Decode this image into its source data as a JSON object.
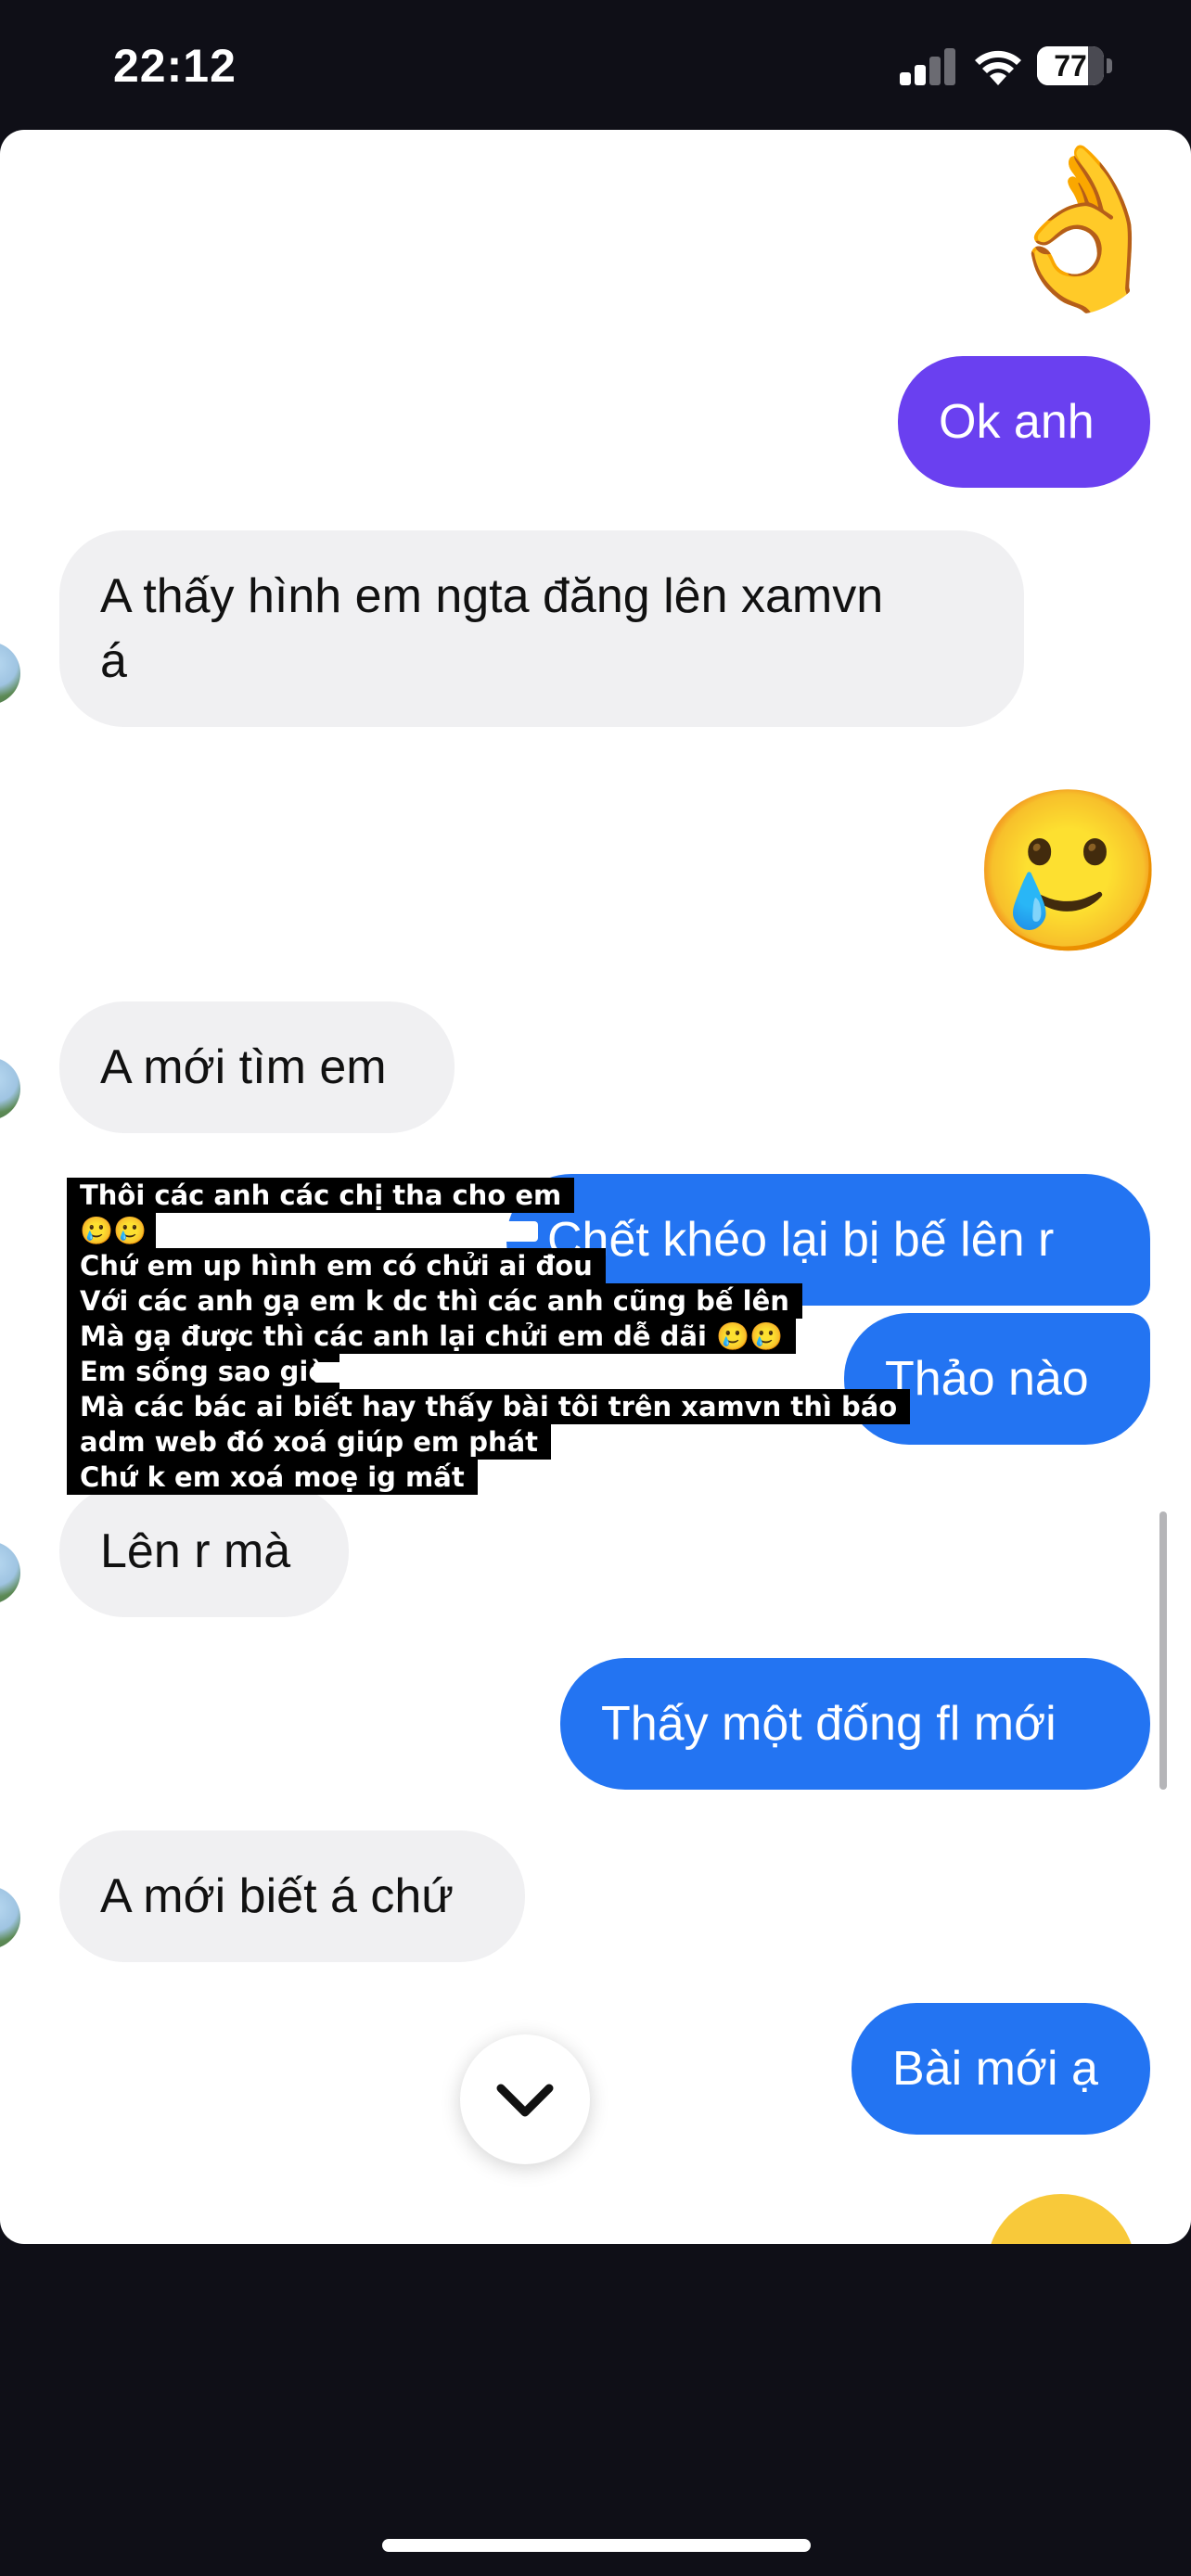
{
  "status_bar": {
    "time": "22:12",
    "battery_percent": 77,
    "battery_label": "77"
  },
  "colors": {
    "outgoing_purple": "#6a40f0",
    "outgoing_blue": "#2374f2",
    "incoming_gray": "#f0f0f2"
  },
  "messages": {
    "m1_emoji": "👌",
    "m2": "Ok anh",
    "m3_line1": "A thấy hình em ngta đăng lên xamvn",
    "m3_line2": "á",
    "m4_emoji": "🥲",
    "m5": "A mới tìm em",
    "m6": "Chết khéo lại bị bế lên r",
    "m7": "Thảo nào",
    "m8": "Lên r mà",
    "m9": "Thấy một đống fl mới",
    "m10": "A mới biết á chứ",
    "m11": "Bài mới ạ"
  },
  "overlay_text": {
    "line1": "Thôi các anh các chị tha cho em",
    "line2": "🥲🥲",
    "line3": "Chứ em up hình em có chửi ai đou",
    "line4": "Với các anh gạ em k dc thì các anh cũng bế lên",
    "line5": "Mà gạ được thì các anh lại chửi em dễ dãi 🥲🥲",
    "line6": "Em sống sao giờ",
    "line7": "Mà các bác ai biết hay thấy bài tôi trên xamvn thì báo",
    "line8": "adm web đó xoá giúp em phát",
    "line9": "Chứ k em xoá moẹ ig mất"
  },
  "icons": {
    "scroll_down": "chevron-down-icon",
    "signal": "cellular-signal-icon",
    "wifi": "wifi-icon",
    "battery": "battery-icon",
    "avatar": "contact-avatar"
  }
}
